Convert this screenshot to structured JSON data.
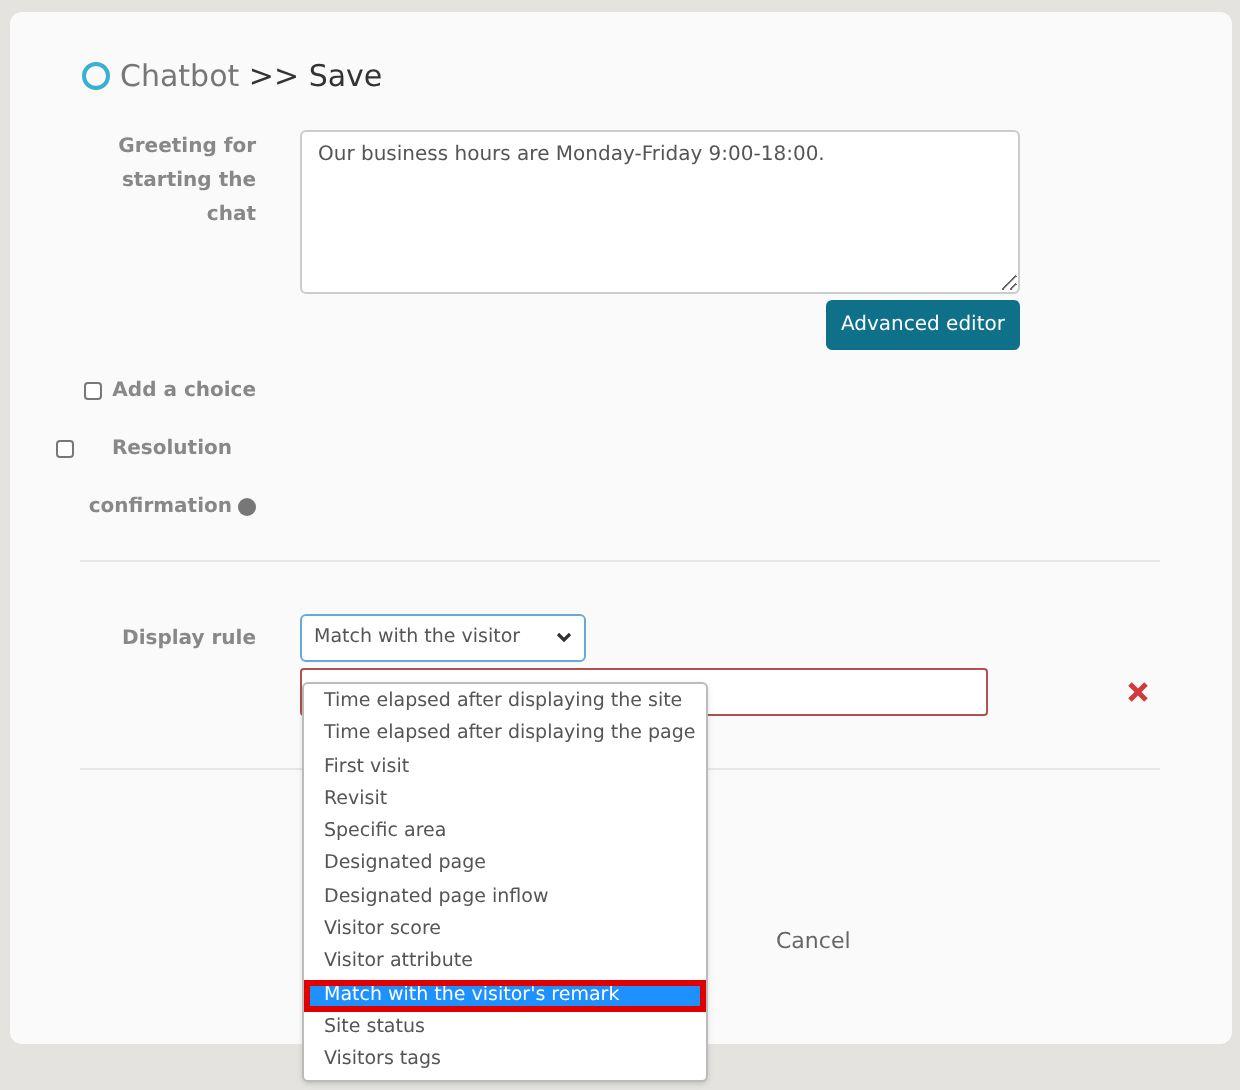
{
  "title": {
    "section": "Chatbot",
    "page": ">> Save"
  },
  "greeting": {
    "label": "Greeting for starting the chat",
    "value": "Our business hours are Monday-Friday 9:00-18:00.",
    "button": "Advanced editor"
  },
  "options": [
    {
      "label": "Add a choice",
      "checked": false,
      "help": false
    },
    {
      "label": "Resolution confirmation",
      "checked": false,
      "help": true
    }
  ],
  "display_rule": {
    "label": "Display rule",
    "value": "Match with the visitor",
    "expanded": true,
    "choices": [
      {
        "label": "Time elapsed after displaying the site",
        "selected": false
      },
      {
        "label": "Time elapsed after displaying the page",
        "selected": false
      },
      {
        "label": "First visit",
        "selected": false
      },
      {
        "label": "Revisit",
        "selected": false
      },
      {
        "label": "Specific area",
        "selected": false
      },
      {
        "label": "Designated page",
        "selected": false
      },
      {
        "label": "Designated page inflow",
        "selected": false
      },
      {
        "label": "Visitor score",
        "selected": false
      },
      {
        "label": "Visitor attribute",
        "selected": false
      },
      {
        "label": "Match with the visitor's remark",
        "selected": true
      },
      {
        "label": "Site status",
        "selected": false
      },
      {
        "label": "Visitors tags",
        "selected": false
      }
    ]
  },
  "cancel": "Cancel"
}
